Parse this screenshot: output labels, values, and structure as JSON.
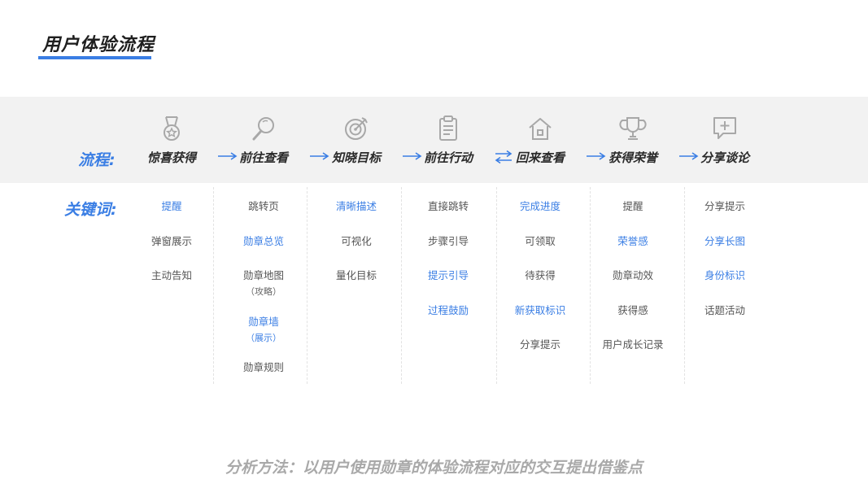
{
  "title": "用户体验流程",
  "flow_label": "流程:",
  "keywords_label": "关键词:",
  "accent_color": "#3a7ee4",
  "steps": [
    {
      "label": "惊喜获得",
      "icon": "medal-icon"
    },
    {
      "label": "前往查看",
      "icon": "magnifier-icon"
    },
    {
      "label": "知晓目标",
      "icon": "target-icon"
    },
    {
      "label": "前往行动",
      "icon": "clipboard-icon"
    },
    {
      "label": "回来查看",
      "icon": "home-icon"
    },
    {
      "label": "获得荣誉",
      "icon": "trophy-icon"
    },
    {
      "label": "分享谈论",
      "icon": "chat-plus-icon"
    }
  ],
  "columns": [
    {
      "items": [
        {
          "text": "提醒",
          "highlight": true
        },
        {
          "text": "弹窗展示",
          "highlight": false
        },
        {
          "text": "主动告知",
          "highlight": false
        }
      ]
    },
    {
      "items": [
        {
          "text": "跳转页",
          "highlight": false
        },
        {
          "text": "勋章总览",
          "highlight": true
        },
        {
          "text": "勋章地图",
          "highlight": false,
          "note": "（攻略）"
        },
        {
          "text": "勋章墙",
          "highlight": true,
          "note": "（展示）"
        },
        {
          "text": "勋章规则",
          "highlight": false
        }
      ]
    },
    {
      "items": [
        {
          "text": "清晰描述",
          "highlight": true
        },
        {
          "text": "可视化",
          "highlight": false
        },
        {
          "text": "量化目标",
          "highlight": false
        }
      ]
    },
    {
      "items": [
        {
          "text": "直接跳转",
          "highlight": false
        },
        {
          "text": "步骤引导",
          "highlight": false
        },
        {
          "text": "提示引导",
          "highlight": true
        },
        {
          "text": "过程鼓励",
          "highlight": true
        }
      ]
    },
    {
      "items": [
        {
          "text": "完成进度",
          "highlight": true
        },
        {
          "text": "可领取",
          "highlight": false
        },
        {
          "text": "待获得",
          "highlight": false
        },
        {
          "text": "新获取标识",
          "highlight": true
        },
        {
          "text": "分享提示",
          "highlight": false
        }
      ]
    },
    {
      "items": [
        {
          "text": "提醒",
          "highlight": false
        },
        {
          "text": "荣誉感",
          "highlight": true
        },
        {
          "text": "勋章动效",
          "highlight": false
        },
        {
          "text": "获得感",
          "highlight": false
        },
        {
          "text": "用户成长记录",
          "highlight": false
        }
      ]
    },
    {
      "items": [
        {
          "text": "分享提示",
          "highlight": false
        },
        {
          "text": "分享长图",
          "highlight": true
        },
        {
          "text": "身份标识",
          "highlight": true
        },
        {
          "text": "话题活动",
          "highlight": false
        }
      ]
    }
  ],
  "footer": "分析方法：以用户使用勋章的体验流程对应的交互提出借鉴点"
}
